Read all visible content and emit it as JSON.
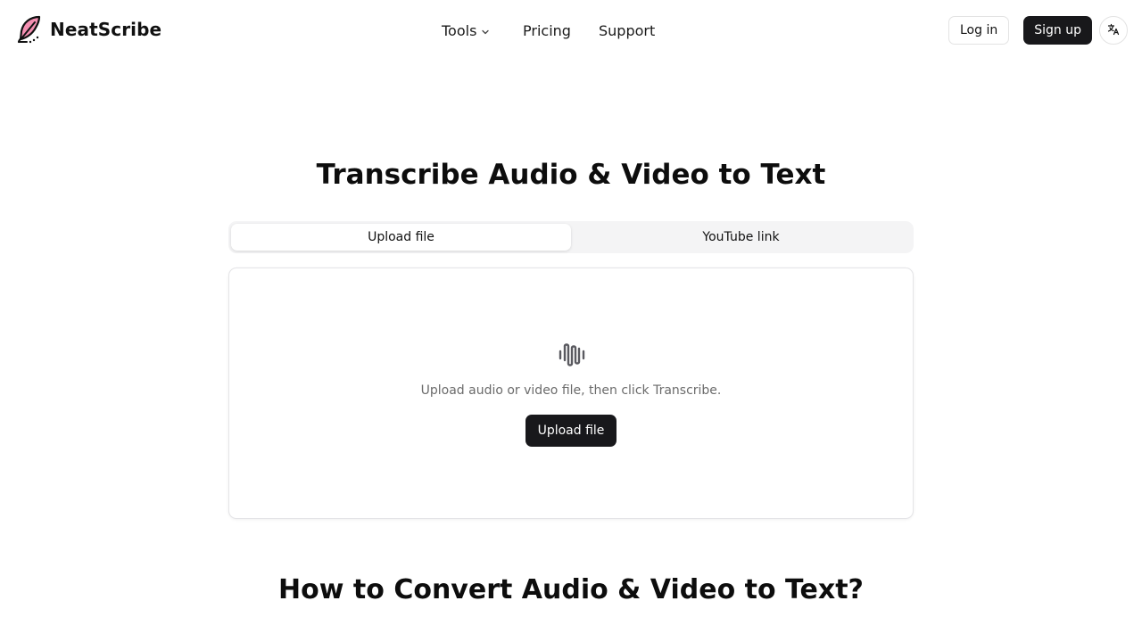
{
  "header": {
    "brand_name": "NeatScribe",
    "logo_icon": "feather-quill-icon",
    "nav": {
      "tools_label": "Tools",
      "tools_chevron_icon": "chevron-down-icon",
      "pricing_label": "Pricing",
      "support_label": "Support"
    },
    "login_label": "Log in",
    "signup_label": "Sign up",
    "language_icon": "translate-icon"
  },
  "hero": {
    "title": "Transcribe Audio & Video to Text"
  },
  "tabs": [
    {
      "label": "Upload file",
      "active": true
    },
    {
      "label": "YouTube link",
      "active": false
    }
  ],
  "upload": {
    "icon": "audio-wave-icon",
    "hint": "Upload audio or video file, then click Transcribe.",
    "button_label": "Upload file"
  },
  "section": {
    "title": "How to Convert Audio & Video to Text?"
  },
  "colors": {
    "primary_button": "#18181b",
    "logo_pink": "#f48fb1",
    "tab_background": "#f4f4f5",
    "border": "#e4e4e7"
  }
}
